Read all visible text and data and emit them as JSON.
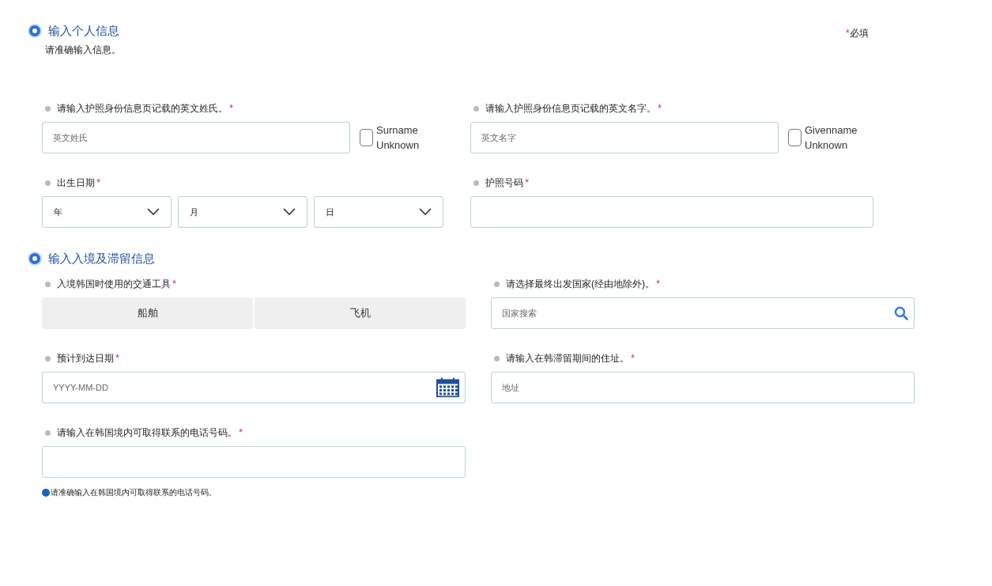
{
  "required_note": {
    "mark": "*",
    "text": "必填"
  },
  "sections": [
    {
      "title": "输入个人信息",
      "subtitle": "请准确输入信息。",
      "rows": [
        [
          {
            "kind": "text_checkbox",
            "label": "请输入护照身份信息页记载的英文姓氏。",
            "mark": "*",
            "placeholder": "英文姓氏",
            "checkbox": {
              "label": "Surname Unknown",
              "checked": false
            }
          },
          {
            "kind": "text_checkbox",
            "label": "请输入护照身份信息页记载的英文名字。",
            "mark": "*",
            "placeholder": "英文名字",
            "checkbox": {
              "label": "Givenname Unknown",
              "checked": false
            }
          }
        ],
        [
          {
            "kind": "selects",
            "label": "出生日期",
            "mark": "*",
            "selects": [
              "年",
              "月",
              "日"
            ]
          },
          {
            "kind": "text",
            "label": "护照号码",
            "mark": "*"
          }
        ]
      ]
    },
    {
      "title": "输入入境及滞留信息",
      "rows": [
        [
          {
            "kind": "segmented",
            "label": "入境韩国时使用的交通工具",
            "mark": "*",
            "options": [
              {
                "label": "船舶",
                "selected": false
              },
              {
                "label": "飞机",
                "selected": false
              }
            ]
          },
          {
            "kind": "search",
            "label": "请选择最终出发国家(经由地除外)。",
            "mark": "*",
            "placeholder": "国家搜索"
          }
        ],
        [
          {
            "kind": "date",
            "label": "预计到达日期",
            "mark": "*",
            "placeholder": "YYYY-MM-DD"
          },
          {
            "kind": "text",
            "label": "请输入在韩滞留期间的住址。",
            "mark": "*",
            "placeholder": "地址"
          }
        ],
        [
          {
            "kind": "text",
            "label": "请输入在韩国境内可取得联系的电话号码。",
            "mark": "*",
            "hint": "请准确输入在韩国境内可取得联系的电话号码。"
          }
        ]
      ]
    }
  ]
}
